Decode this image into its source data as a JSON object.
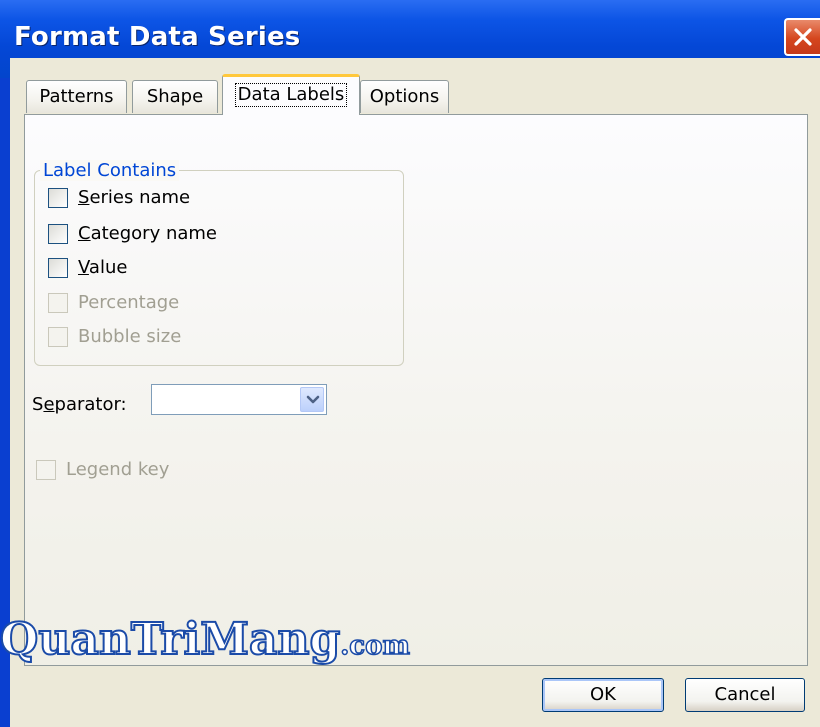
{
  "window": {
    "title": "Format Data Series"
  },
  "tabs": [
    {
      "label": "Patterns",
      "active": false
    },
    {
      "label": "Shape",
      "active": false
    },
    {
      "label": "Data Labels",
      "active": true
    },
    {
      "label": "Options",
      "active": false
    }
  ],
  "label_contains": {
    "title": "Label Contains",
    "options": [
      {
        "mnemonic": "S",
        "rest": "eries name",
        "checked": false,
        "enabled": true
      },
      {
        "mnemonic": "C",
        "rest": "ategory name",
        "checked": false,
        "enabled": true
      },
      {
        "mnemonic": "V",
        "rest": "alue",
        "checked": false,
        "enabled": true
      },
      {
        "mnemonic": "",
        "rest": "Percentage",
        "checked": false,
        "enabled": false
      },
      {
        "mnemonic": "",
        "rest": "Bubble size",
        "checked": false,
        "enabled": false
      }
    ]
  },
  "separator": {
    "label_pre": "S",
    "label_mnemonic": "e",
    "label_post": "parator:",
    "value": ""
  },
  "legend_key": {
    "label": "Legend key",
    "checked": false,
    "enabled": false
  },
  "buttons": {
    "ok": "OK",
    "cancel": "Cancel"
  },
  "watermark": {
    "main": "QuanTriMang",
    "suffix": ".com"
  },
  "colors": {
    "title_bar": "#0447d6",
    "group_label": "#0046d5",
    "dialog_face": "#ece9d8",
    "tab_highlight": "#ffc83c"
  },
  "icons": {
    "close": "close-icon",
    "dropdown": "chevron-down-icon"
  }
}
